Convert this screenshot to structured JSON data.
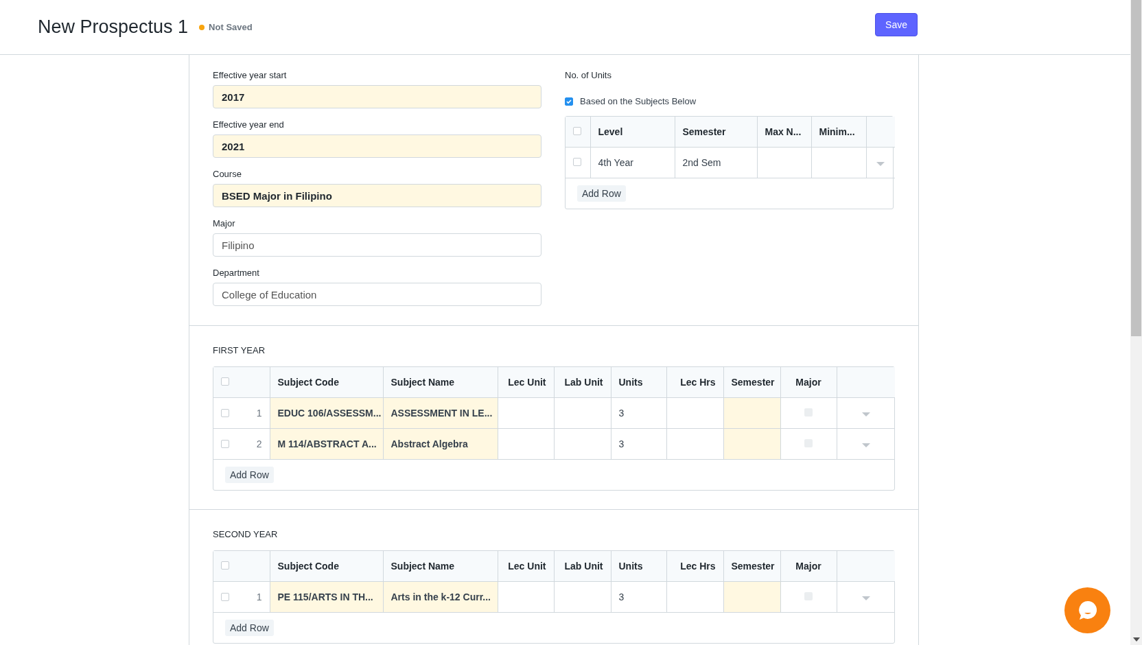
{
  "header": {
    "title": "New Prospectus 1",
    "status": {
      "label": "Not Saved",
      "color": "#f8a40e"
    },
    "save_button": "Save"
  },
  "fields": [
    {
      "label": "Effective year start",
      "value": "2017",
      "required": true
    },
    {
      "label": "Effective year end",
      "value": "2021",
      "required": true
    },
    {
      "label": "Course",
      "value": "BSED Major in Filipino",
      "required": true
    },
    {
      "label": "Major",
      "value": "Filipino",
      "required": false
    },
    {
      "label": "Department",
      "value": "College of Education",
      "required": false
    }
  ],
  "units": {
    "label": "No. of Units",
    "option": {
      "label": "Based on the Subjects Below",
      "checked": true
    },
    "table": {
      "select_all": false,
      "columns": [
        "Level",
        "Semester",
        "Max N...",
        "Minim..."
      ],
      "rows": [
        {
          "checked": false,
          "cells": [
            "4th Year",
            "2nd Sem",
            "",
            ""
          ]
        }
      ],
      "add_row": "Add Row"
    }
  },
  "sections": [
    {
      "title": "FIRST YEAR",
      "table": {
        "select_all": false,
        "columns": [
          {
            "label": "Subject Code",
            "required": true
          },
          {
            "label": "Subject Name",
            "required": true
          },
          {
            "label": "Lec Unit",
            "required": false
          },
          {
            "label": "Lab Unit",
            "required": false
          },
          {
            "label": "Units",
            "required": false
          },
          {
            "label": "Lec Hrs",
            "required": false
          },
          {
            "label": "Semester",
            "required": true
          },
          {
            "label": "Major",
            "required": false
          }
        ],
        "rows": [
          {
            "checked": false,
            "number": "1",
            "cells": [
              "EDUC 106/ASSESSM...",
              "ASSESSMENT IN LE...",
              "",
              "",
              "3",
              "",
              ""
            ],
            "major": false
          },
          {
            "checked": false,
            "number": "2",
            "cells": [
              "M 114/ABSTRACT A...",
              "Abstract Algebra",
              "",
              "",
              "3",
              "",
              ""
            ],
            "major": false
          }
        ],
        "add_row": "Add Row"
      }
    },
    {
      "title": "SECOND YEAR",
      "table": {
        "select_all": false,
        "columns": [
          {
            "label": "Subject Code",
            "required": true
          },
          {
            "label": "Subject Name",
            "required": true
          },
          {
            "label": "Lec Unit",
            "required": false
          },
          {
            "label": "Lab Unit",
            "required": false
          },
          {
            "label": "Units",
            "required": false
          },
          {
            "label": "Lec Hrs",
            "required": false
          },
          {
            "label": "Semester",
            "required": true
          },
          {
            "label": "Major",
            "required": false
          }
        ],
        "rows": [
          {
            "checked": false,
            "number": "1",
            "cells": [
              "PE 115/ARTS IN TH...",
              "Arts in the k-12 Curr...",
              "",
              "",
              "3",
              "",
              ""
            ],
            "major": false
          }
        ],
        "add_row": "Add Row"
      }
    }
  ]
}
